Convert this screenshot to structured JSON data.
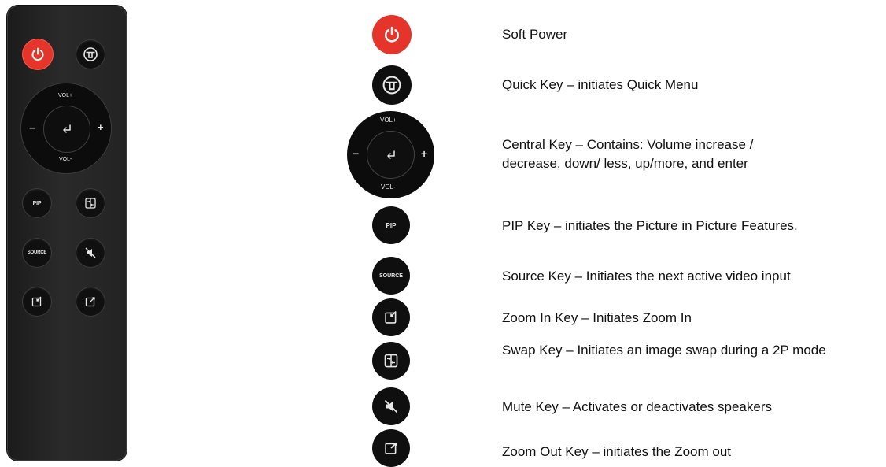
{
  "remote": {
    "vol_plus": "VOL+",
    "vol_minus": "VOL-",
    "minus": "−",
    "plus": "+",
    "pip": "PIP",
    "source": "SOURCE"
  },
  "keys": [
    {
      "label": "Soft Power",
      "icon": "power-icon",
      "color": "#e5342a"
    },
    {
      "label": "Quick Key – initiates Quick Menu",
      "icon": "quick-menu-icon"
    },
    {
      "label": "Central Key – Contains: Volume increase / decrease, down/ less, up/more, and enter",
      "icon": "enter-icon",
      "vol_plus": "VOL+",
      "vol_minus": "VOL-",
      "minus": "−",
      "plus": "+"
    },
    {
      "label": "PIP Key – initiates the Picture in Picture Features.",
      "icon_text": "PIP"
    },
    {
      "label": "Source Key – Initiates the next active video input",
      "icon_text": "SOURCE"
    },
    {
      "label": "Zoom In Key – Initiates Zoom In",
      "icon": "zoom-in-icon"
    },
    {
      "label": "Swap Key – Initiates an image swap during a 2P mode",
      "icon": "swap-icon"
    },
    {
      "label": "Mute Key – Activates or deactivates speakers",
      "icon": "mute-icon"
    },
    {
      "label": "Zoom Out Key – initiates the Zoom out",
      "icon": "zoom-out-icon"
    }
  ]
}
